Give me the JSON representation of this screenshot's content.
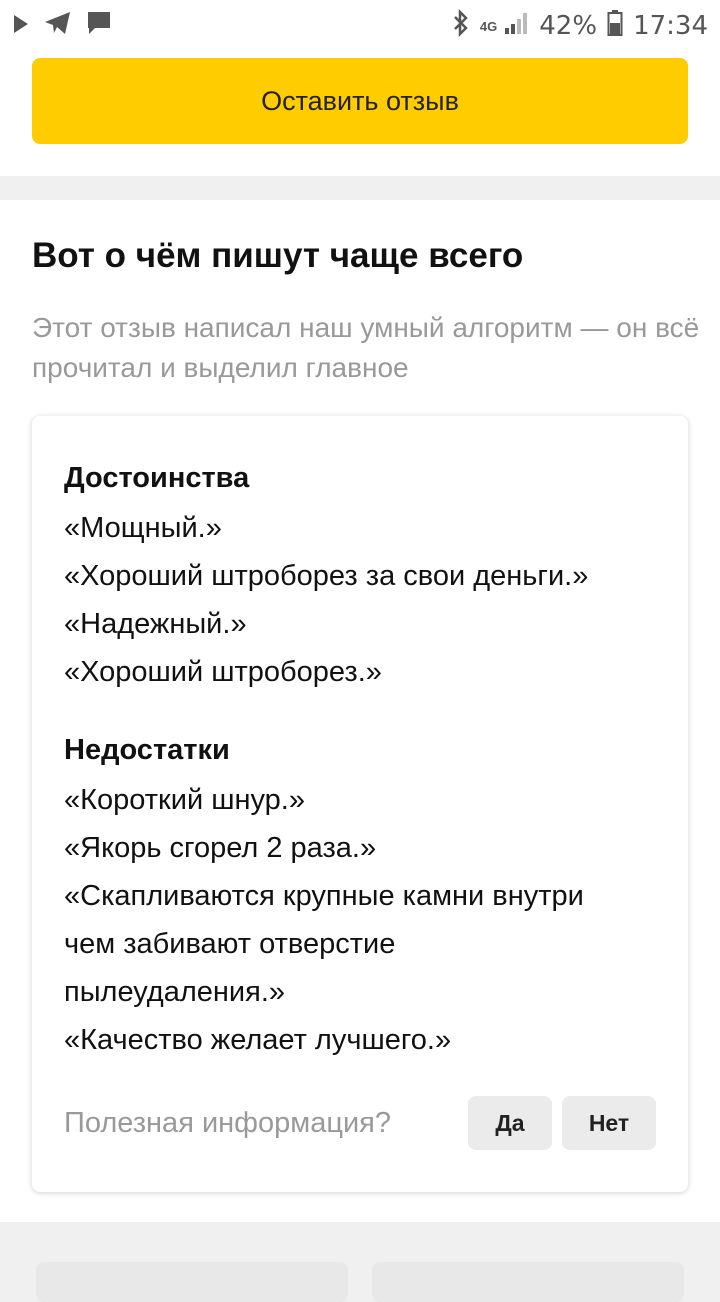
{
  "status_bar": {
    "battery_percent": "42%",
    "time": "17:34",
    "network": "4G",
    "icons": [
      "play-icon",
      "telegram-icon",
      "chat-icon",
      "bluetooth-icon",
      "signal-icon",
      "battery-icon"
    ]
  },
  "actions": {
    "leave_review_label": "Оставить отзыв",
    "accent_color": "#ffcc00"
  },
  "summary": {
    "title": "Вот о чём пишут чаще всего",
    "subtitle": "Этот отзыв написал наш умный алгоритм — он всё прочитал и выделил главное",
    "pros_heading": "Достоинства",
    "pros": [
      "«Мощный.»",
      "«Хороший штроборез за свои деньги.»",
      "«Надежный.»",
      "«Хороший штроборез.»"
    ],
    "cons_heading": "Недостатки",
    "cons": [
      "«Короткий шнур.»",
      "«Якорь сгорел 2 раза.»",
      "«Скапливаются крупные камни внутри",
      "чем забивают отверстие",
      "пылеудаления.»",
      "«Качество желает лучшего.»"
    ],
    "helpful_question": "Полезная информация?",
    "yes_label": "Да",
    "no_label": "Нет"
  }
}
